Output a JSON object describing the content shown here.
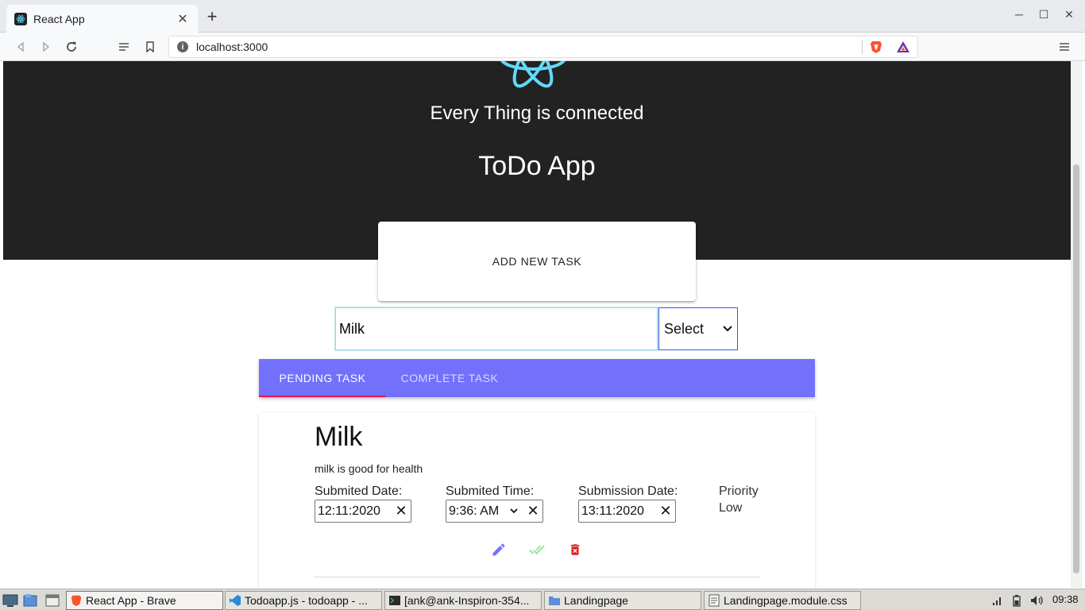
{
  "browser": {
    "tab_title": "React App",
    "tab_close": "✕",
    "new_tab": "+",
    "url": "localhost:3000",
    "window_controls": [
      "─",
      "☐",
      "✕"
    ]
  },
  "page": {
    "tagline": "Every Thing is connected",
    "app_title": "ToDo App",
    "add_task_label": "ADD NEW TASK",
    "task_input_value": "Milk",
    "priority_select": "Select",
    "tabs": [
      {
        "label": "PENDING TASK",
        "active": true
      },
      {
        "label": "COMPLETE TASK",
        "active": false
      }
    ],
    "task": {
      "title": "Milk",
      "description": "milk is good for health",
      "submitted_date_label": "Submited Date:",
      "submitted_date_value": "12:11:2020",
      "submitted_time_label": "Submited Time:",
      "submitted_time_value": "9:36: AM",
      "submission_date_label": "Submission Date:",
      "submission_date_value": "13:11:2020",
      "priority_label": "Priority",
      "priority_value": "Low",
      "clear_symbol": "✕"
    }
  },
  "taskbar": {
    "apps": [
      {
        "label": "React App - Brave",
        "active": true
      },
      {
        "label": "Todoapp.js - todoapp - ...",
        "active": false
      },
      {
        "label": "[ank@ank-Inspiron-354...",
        "active": false
      },
      {
        "label": "Landingpage",
        "active": false
      },
      {
        "label": "Landingpage.module.css",
        "active": false
      }
    ],
    "clock": "09:38"
  },
  "colors": {
    "hero_bg": "#222222",
    "tabs_bg": "#7371fc",
    "tab_indicator": "#f50057",
    "react_logo": "#61dafb",
    "edit_icon": "#7371fc",
    "complete_icon": "#8be08b",
    "delete_icon": "#e01b1b"
  }
}
